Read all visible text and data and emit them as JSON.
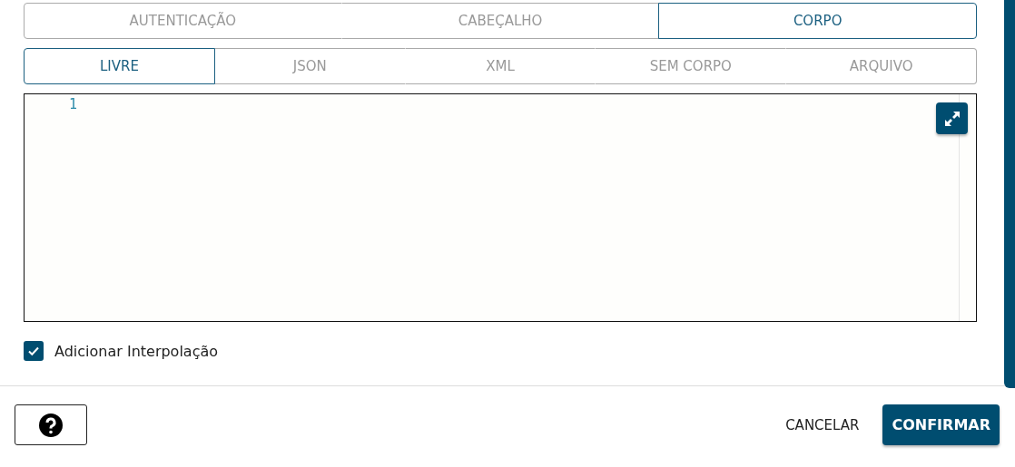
{
  "main_tabs": [
    {
      "label": "AUTENTICAÇÃO",
      "selected": false
    },
    {
      "label": "CABEÇALHO",
      "selected": false
    },
    {
      "label": "CORPO",
      "selected": true
    }
  ],
  "body_tabs": [
    {
      "label": "LIVRE",
      "selected": true
    },
    {
      "label": "JSON",
      "selected": false
    },
    {
      "label": "XML",
      "selected": false
    },
    {
      "label": "SEM CORPO",
      "selected": false
    },
    {
      "label": "ARQUIVO",
      "selected": false
    }
  ],
  "editor": {
    "line_numbers": [
      "1"
    ]
  },
  "interpolation": {
    "label": "Adicionar Interpolação",
    "checked": true
  },
  "footer": {
    "cancel": "CANCELAR",
    "confirm": "CONFIRMAR"
  }
}
